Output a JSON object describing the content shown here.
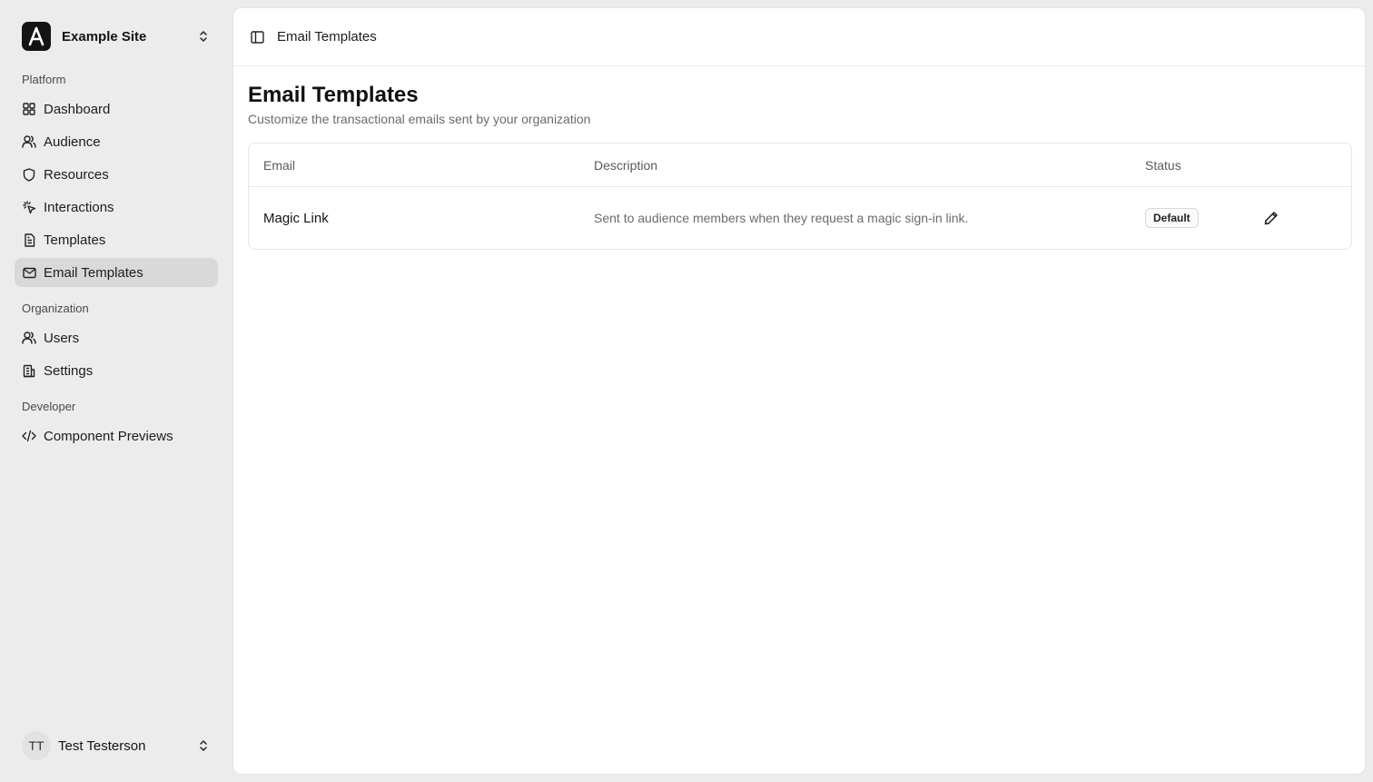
{
  "sidebar": {
    "site_name": "Example Site",
    "sections": {
      "platform": "Platform",
      "organization": "Organization",
      "developer": "Developer"
    },
    "items": [
      {
        "label": "Dashboard",
        "icon": "grid-icon"
      },
      {
        "label": "Audience",
        "icon": "users-icon"
      },
      {
        "label": "Resources",
        "icon": "shield-icon"
      },
      {
        "label": "Interactions",
        "icon": "pointer-icon"
      },
      {
        "label": "Templates",
        "icon": "file-icon"
      },
      {
        "label": "Email Templates",
        "icon": "mail-icon",
        "active": true
      },
      {
        "label": "Users",
        "icon": "users-icon"
      },
      {
        "label": "Settings",
        "icon": "building-icon"
      },
      {
        "label": "Component Previews",
        "icon": "code-icon"
      }
    ],
    "user": {
      "initials": "TT",
      "name": "Test Testerson"
    }
  },
  "header": {
    "title": "Email Templates"
  },
  "page": {
    "title": "Email Templates",
    "subtitle": "Customize the transactional emails sent by your organization"
  },
  "table": {
    "columns": [
      "Email",
      "Description",
      "Status"
    ],
    "rows": [
      {
        "email": "Magic Link",
        "description": "Sent to audience members when they request a magic sign-in link.",
        "status": "Default"
      }
    ]
  }
}
